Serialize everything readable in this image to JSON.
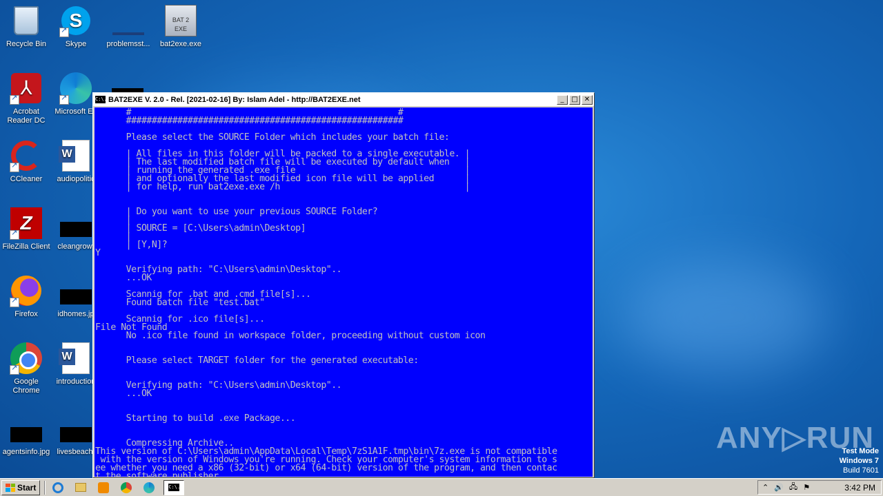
{
  "desktop": {
    "icons": [
      {
        "label": "Recycle Bin"
      },
      {
        "label": "Skype"
      },
      {
        "label": "problemsst..."
      },
      {
        "label": "bat2exe.exe"
      },
      {
        "label": "Acrobat Reader DC"
      },
      {
        "label": "Microsoft Ed"
      },
      {
        "label": "CCleaner"
      },
      {
        "label": "audiopolitic"
      },
      {
        "label": "FileZilla Client"
      },
      {
        "label": "cleangrowt"
      },
      {
        "label": "Firefox"
      },
      {
        "label": "idhomes.jp"
      },
      {
        "label": "Google Chrome"
      },
      {
        "label": "introduction"
      },
      {
        "label": "agentsinfo.jpg"
      },
      {
        "label": "livesbeach."
      }
    ],
    "bat2exe_icon_text": "BAT 2 EXE"
  },
  "console_window": {
    "title": "BAT2EXE V. 2.0 - Rel. [2021-02-16] By: Islam Adel - http://BAT2EXE.net",
    "icon_text": "C:\\.",
    "buttons": {
      "minimize": "_",
      "maximize": "□",
      "close": "✕"
    },
    "lines": [
      "      #                                                    #",
      "      ######################################################",
      "",
      "      Please select the SOURCE Folder which includes your batch file:",
      "",
      "      | All files in this folder will be packed to a single executable. |",
      "      | The last modified batch file will be executed by default when   |",
      "      | running the generated .exe file                                 |",
      "      | and optionally the last modified icon file will be applied      |",
      "      | for help, run bat2exe.exe /h                                    |",
      "",
      "",
      "      | Do you want to use your previous SOURCE Folder?",
      "      |",
      "      | SOURCE = [C:\\Users\\admin\\Desktop]",
      "      |",
      "      | [Y,N]?",
      "Y",
      "",
      "      Verifying path: \"C:\\Users\\admin\\Desktop\"..",
      "      ...OK",
      "",
      "      Scannig for .bat and .cmd file[s]...",
      "      Found batch file \"test.bat\"",
      "",
      "      Scannig for .ico file[s]...",
      "File Not Found",
      "      No .ico file found in workspace folder, proceeding without custom icon",
      "",
      "",
      "      Please select TARGET folder for the generated executable:",
      "",
      "",
      "      Verifying path: \"C:\\Users\\admin\\Desktop\"..",
      "      ...OK",
      "",
      "",
      "      Starting to build .exe Package...",
      "",
      "",
      "      Compressing Archive..",
      "This version of C:\\Users\\admin\\AppData\\Local\\Temp\\7zS1A1F.tmp\\bin\\7z.exe is not compatible",
      " with the version of Windows you're running. Check your computer's system information to s",
      "ee whether you need a x86 (32-bit) or x64 (64-bit) version of the program, and then contac",
      "t the software publisher."
    ]
  },
  "taskbar": {
    "start_label": "Start",
    "clock": "3:42 PM",
    "cmd_icon_text": "C:\\."
  },
  "watermark": {
    "brand": "ANY▷RUN",
    "test_mode": "Test Mode",
    "os": "Windows 7",
    "build": "Build 7601"
  }
}
